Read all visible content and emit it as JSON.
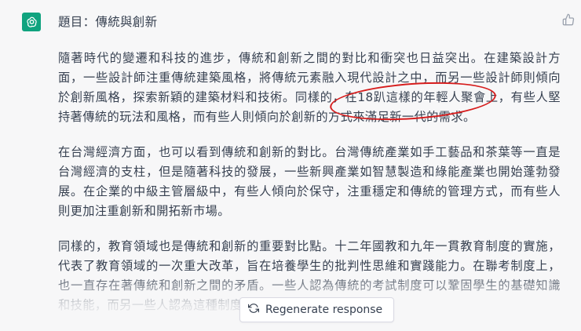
{
  "heading": "題目：傳統與創新",
  "paragraphs": [
    {
      "text": "隨著時代的變遷和科技的進步，傳統和創新之間的對比和衝突也日益突出。在建築設計方面，一些設計師注重傳統建築風格，將傳統元素融入現代設計之中，而另一些設計師則傾向於創新風格，探索新穎的建築材料和技術。同樣的，"
    },
    {
      "text": "在台灣經濟方面，也可以看到傳統和創新的對比。台灣傳統產業如手工藝品和茶葉等一直是台灣經濟的支柱，但是隨著科技的發展，一些新興產業如智慧製造和綠能產業也開始蓬勃發展。在企業的中級主管層級中，有些人傾向於保守，注重穩定和傳統的管理方式，而有些人則更加注重創新和開拓新市場。"
    },
    {
      "text": "同樣的，教育領域也是傳統和創新的重要對比點。十二年國教和九年一貫教育制度的實施，代表了教育領域的一次重大改革，旨在培養學生的批判性思維和實踐能力。在聯考制度上，也一直存在著傳統和創新之間的矛盾。一些人認為傳統的考試制度可以鞏固學生的基礎知識和技能，而另一些人認為這種制度過於僵化，應該"
    }
  ],
  "annotated_text": "在18趴這樣的年輕人聚會上",
  "after_annotation": "，有些人堅持著傳統的玩法和風格，而有些人則傾向於創新的方式來滿足新一代的需求。",
  "regenerate_label": "Regenerate response",
  "icons": {
    "avatar": "openai-logo-icon",
    "thumb": "thumbs-up-icon",
    "regen": "refresh-icon"
  },
  "colors": {
    "avatar_bg": "#10a37f",
    "annotation": "#d61c1c",
    "text": "#374151",
    "background": "#f7f7f8"
  }
}
